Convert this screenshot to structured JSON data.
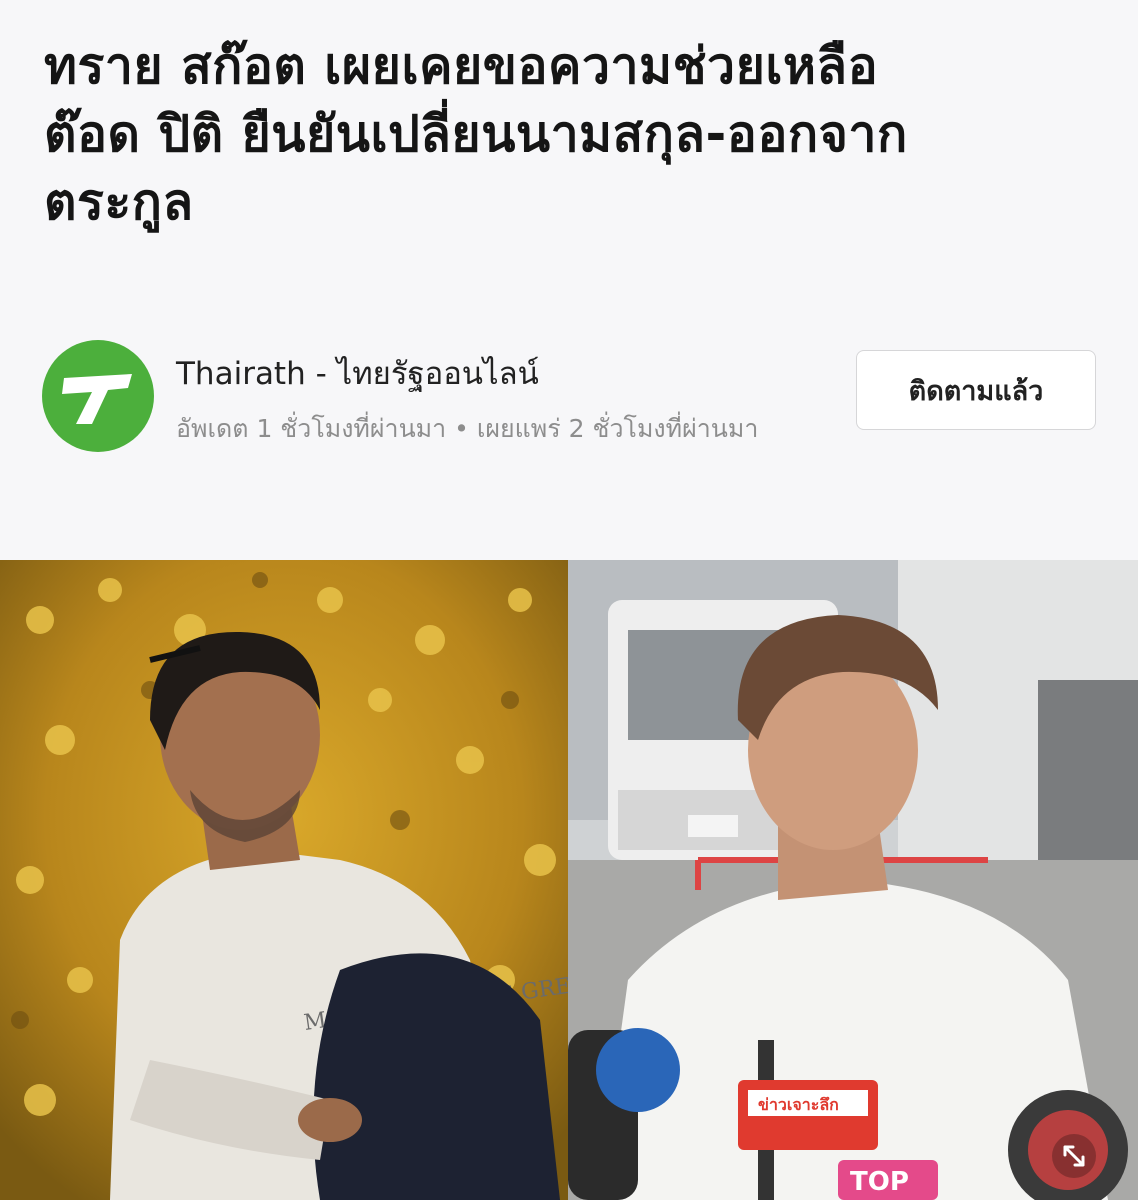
{
  "headline": {
    "lines": [
      "ทราย สก๊อต เผยเคยขอความช่วยเหลือ",
      "ต๊อด ปิติ ยืนยันเปลี่ยนนามสกุล-ออกจาก",
      "ตระกูล"
    ]
  },
  "source": {
    "name": "Thairath - ไทยรัฐออนไลน์",
    "meta": "อัพเดต 1 ชั่วโมงที่ผ่านมา • เผยแพร่ 2 ชั่วโมงที่ผ่านมา",
    "logo_icon": "thairath-t-logo-icon",
    "logo_color": "#4caf3c"
  },
  "follow_button": {
    "label": "ติดตามแล้ว"
  },
  "photo": {
    "left_icon": "man-in-front-of-yellow-flowers-photo",
    "right_icon": "man-at-press-microphones-photo",
    "sweater_text": "MARTHE FIANOIS GRE",
    "sign_text": "ข่าวเจาะลึก",
    "badge_text": "TOP",
    "expand_icon": "expand-arrows-icon"
  }
}
